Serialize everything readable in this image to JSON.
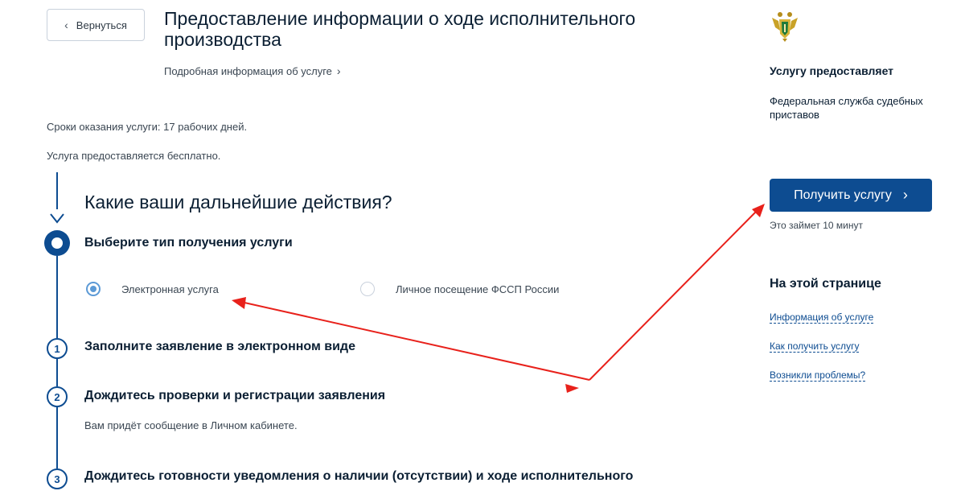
{
  "header": {
    "back_label": "Вернуться",
    "title": "Предоставление информации о ходе исполнительного производства",
    "details_link": "Подробная информация об услуге"
  },
  "service_info": {
    "terms": "Сроки оказания услуги: 17 рабочих дней.",
    "cost": "Услуга предоставляется бесплатно."
  },
  "steps": {
    "heading": "Какие ваши дальнейшие действия?",
    "current": {
      "title": "Выберите тип получения услуги",
      "options": [
        {
          "label": "Электронная услуга",
          "selected": true
        },
        {
          "label": "Личное посещение ФССП России",
          "selected": false
        }
      ]
    },
    "items": [
      {
        "number": "1",
        "title": "Заполните заявление в электронном виде",
        "note": ""
      },
      {
        "number": "2",
        "title": "Дождитесь проверки и регистрации заявления",
        "note": "Вам придёт сообщение в Личном кабинете."
      },
      {
        "number": "3",
        "title": "Дождитесь готовности уведомления о наличии (отсутствии) и ходе исполнительного",
        "note": ""
      }
    ]
  },
  "sidebar": {
    "provider_label": "Услугу предоставляет",
    "provider_name": "Федеральная служба судебных приставов",
    "get_service_button": "Получить услугу",
    "time_note": "Это займет 10 минут",
    "toc_title": "На этой странице",
    "toc_links": [
      "Информация об услуге",
      "Как получить услугу",
      "Возникли проблемы?"
    ]
  },
  "icons": {
    "back": "chevron-left-icon",
    "details": "chevron-right-icon",
    "emblem": "fssp-emblem-icon",
    "button": "chevron-right-icon"
  },
  "colors": {
    "primary": "#0d4c91",
    "radio_accent": "#5c9ad6",
    "annotation": "#e8211b"
  }
}
